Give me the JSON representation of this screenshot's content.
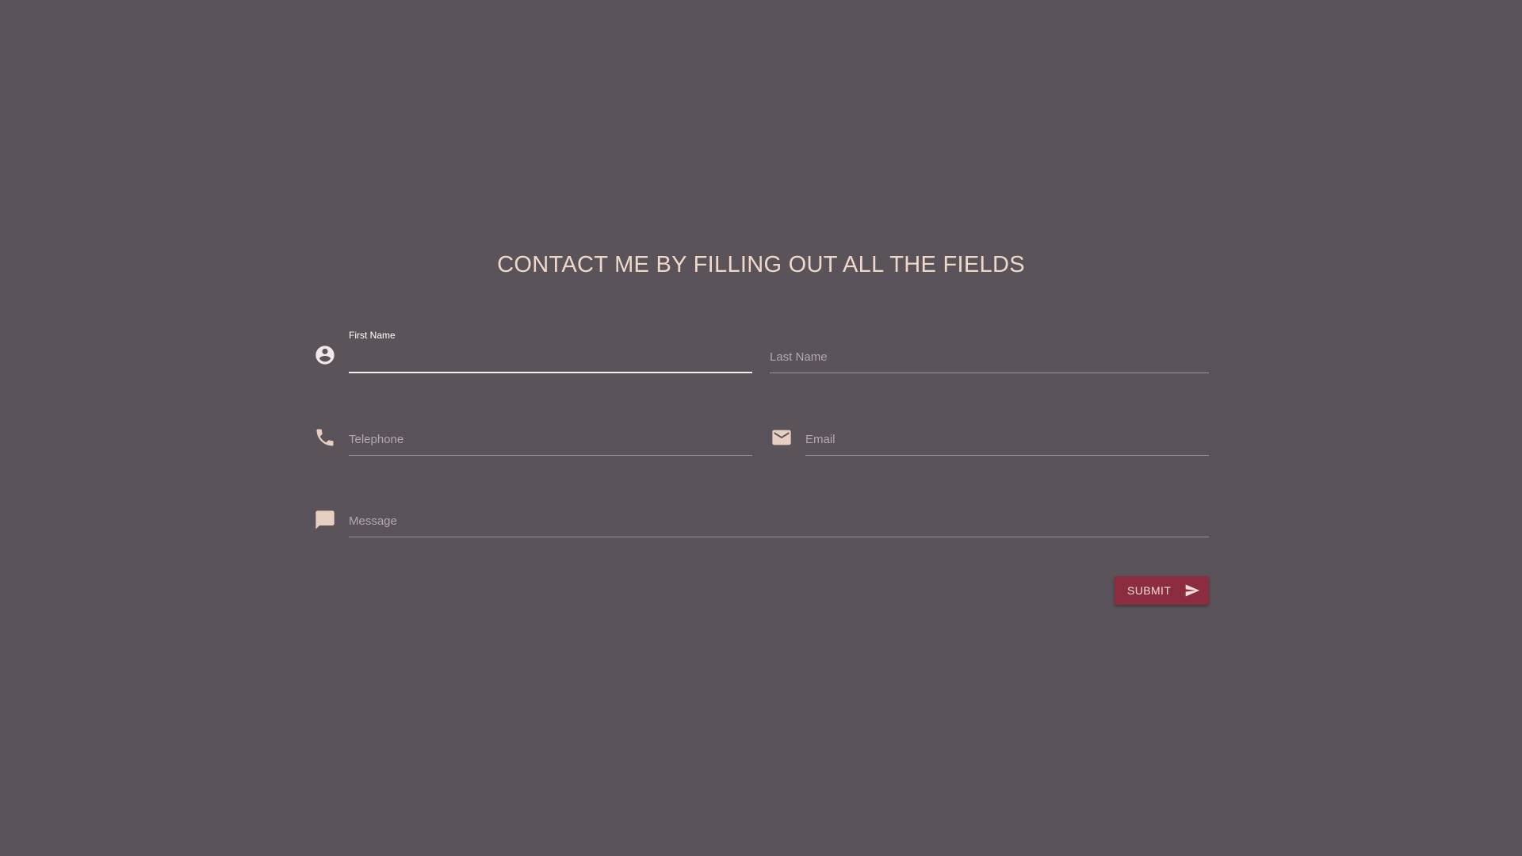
{
  "form": {
    "title": "CONTACT ME BY FILLING OUT ALL THE FIELDS",
    "fields": {
      "first_name": {
        "label": "First Name",
        "value": ""
      },
      "last_name": {
        "label": "Last Name",
        "value": ""
      },
      "telephone": {
        "label": "Telephone",
        "value": ""
      },
      "email": {
        "label": "Email",
        "value": ""
      },
      "message": {
        "label": "Message",
        "value": ""
      }
    },
    "submit_label": "SUBMIT"
  },
  "icons": {
    "first_name": "account-circle-icon",
    "telephone": "phone-icon",
    "email": "mail-icon",
    "message": "chat-bubble-icon",
    "submit": "send-icon"
  },
  "colors": {
    "background": "#5b535a",
    "title": "#efd8ca",
    "accent_button": "#8b2c3f",
    "icon_light": "#efe7ea",
    "icon_tan": "#e6cfc1"
  }
}
